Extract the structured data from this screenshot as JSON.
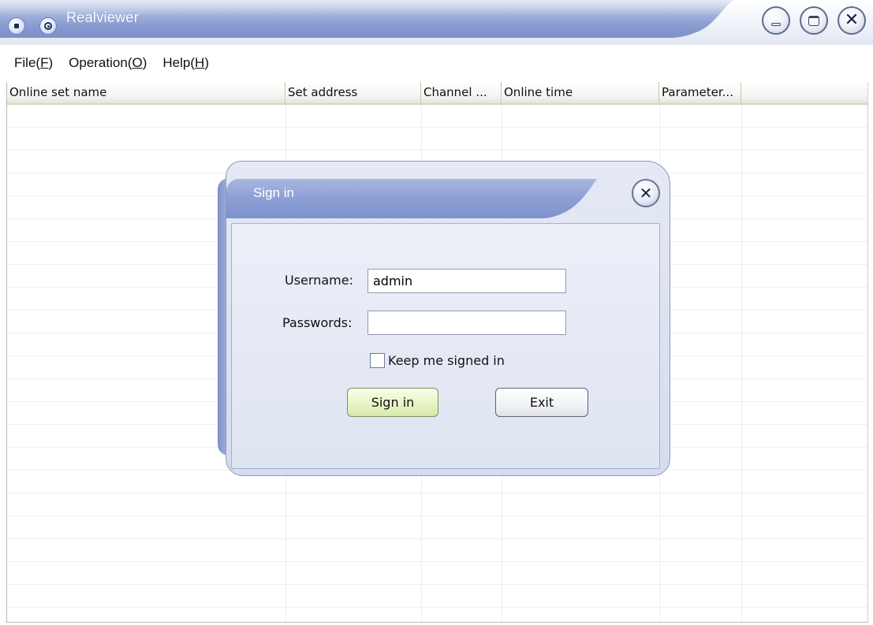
{
  "window": {
    "title": "Realviewer",
    "controls": {
      "minimize_icon": "minimize-icon",
      "maximize_icon": "maximize-icon",
      "close_glyph": "✕"
    }
  },
  "menu": {
    "items": [
      {
        "label": "File",
        "mnemonic": "F"
      },
      {
        "label": "Operation",
        "mnemonic": "O"
      },
      {
        "label": "Help",
        "mnemonic": "H"
      }
    ]
  },
  "table": {
    "columns": [
      "Online set name",
      "Set address",
      "Channel ...",
      "Online time",
      "Parameter..."
    ],
    "rows": []
  },
  "dialog": {
    "title": "Sign in",
    "close_glyph": "✕",
    "username_label": "Username:",
    "username_value": "admin",
    "password_label": "Passwords:",
    "password_value": "",
    "keep_signed_in_label": "Keep me signed in",
    "keep_signed_in_checked": false,
    "sign_in_button": "Sign in",
    "exit_button": "Exit"
  }
}
